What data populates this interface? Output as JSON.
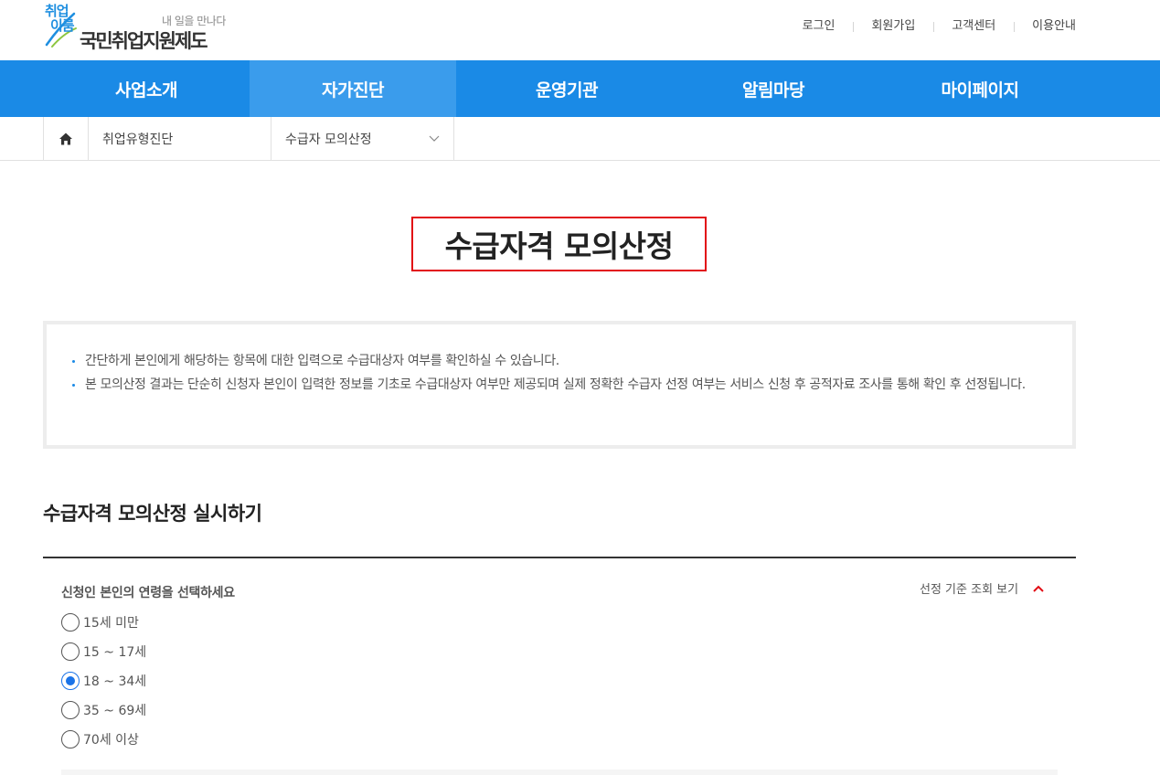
{
  "header": {
    "logo": {
      "line1": "취업",
      "line2": "이룸",
      "tagline": "내 일을 만나다",
      "name": "국민취업지원제도"
    },
    "top_links": [
      "로그인",
      "회원가입",
      "고객센터",
      "이용안내"
    ]
  },
  "gnb": {
    "items": [
      "사업소개",
      "자가진단",
      "운영기관",
      "알림마당",
      "마이페이지"
    ],
    "active": "자가진단"
  },
  "breadcrumb": {
    "home_icon": "home-icon",
    "level1": "취업유형진단",
    "level2": "수급자 모의산정"
  },
  "page": {
    "title": "수급자격 모의산정"
  },
  "info": {
    "items": [
      "간단하게 본인에게 해당하는 항목에 대한 입력으로 수급대상자 여부를 확인하실 수 있습니다.",
      "본 모의산정 결과는 단순히 신청자 본인이 입력한 정보를 기초로 수급대상자 여부만 제공되며 실제 정확한 수급자 선정 여부는 서비스 신청 후 공적자료 조사를 통해 확인 후 선정됩니다."
    ]
  },
  "section": {
    "title": "수급자격 모의산정 실시하기",
    "question": "신청인 본인의 연령을 선택하세요",
    "criteria_link": "선정 기준 조회 보기",
    "age_options": [
      "15세 미만",
      "15 ~ 17세",
      "18 ~ 34세",
      "35 ~ 69세",
      "70세 이상"
    ],
    "selected_option": "18 ~ 34세"
  },
  "colors": {
    "gnb": "#1a8ae6",
    "gnb_active": "#3a9cec",
    "title_border": "#e20d15",
    "criteria_chevron": "#e20d15",
    "radio_checked": "#1a73e8"
  }
}
